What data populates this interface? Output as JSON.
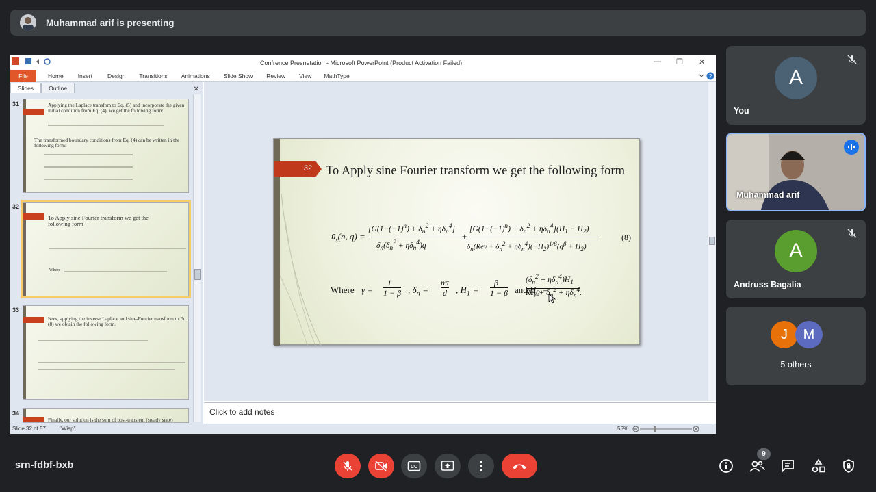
{
  "presenting_banner": "Muhammad arif is presenting",
  "ppt": {
    "window_title": "Confrence Presnetation  -  Microsoft PowerPoint (Product Activation Failed)",
    "tabs": [
      "File",
      "Home",
      "Insert",
      "Design",
      "Transitions",
      "Animations",
      "Slide Show",
      "Review",
      "View",
      "MathType"
    ],
    "pane_tabs": [
      "Slides",
      "Outline"
    ],
    "thumbs": [
      {
        "num": "31",
        "text": "Applying the Laplace transfom to Eq. (5) and incorporate the given initial condition from Eq. (4), we get the following form:",
        "text2": "The transformed boundary conditions from Eq. (4) can be written in the following form:"
      },
      {
        "num": "32",
        "text": "To Apply sine Fourier transform we get the following form",
        "text2": "Where"
      },
      {
        "num": "33",
        "text": "Now, applying the inverse Laplace and sine-Fourier transform to Eq. (8) we obtain the following form.",
        "text2": ""
      },
      {
        "num": "34",
        "text": "Finally, our solution is the sum of post-transient (steady state)",
        "text2": ""
      }
    ],
    "slide": {
      "number": "32",
      "title": "To Apply sine Fourier transform we get the following form",
      "eq_number": "(8)",
      "where_label": "Where",
      "and_label": "and"
    },
    "notes_placeholder": "Click to add notes",
    "status_slide": "Slide 32 of 57",
    "status_theme": "\"Wisp\"",
    "zoom": "55%"
  },
  "participants": [
    {
      "name": "You",
      "initial": "A",
      "color": "#4a6274",
      "muted": true
    },
    {
      "name": "Muhammad arif",
      "speaking": true
    },
    {
      "name": "Andruss Bagalia",
      "initial": "A",
      "color": "#5a9e2f",
      "muted": true
    },
    {
      "name": "5 others",
      "initials": [
        "J",
        "M"
      ],
      "colors": [
        "#e8710a",
        "#5c6bc0"
      ]
    }
  ],
  "meeting_code": "srn-fdbf-bxb",
  "people_count": "9"
}
